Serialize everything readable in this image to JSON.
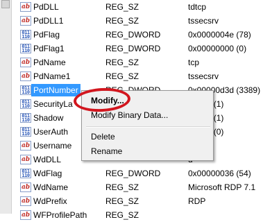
{
  "rows": [
    {
      "name": "PdDLL",
      "type": "REG_SZ",
      "data": "tdtcp",
      "icon": "string-value-icon"
    },
    {
      "name": "PdDLL1",
      "type": "REG_SZ",
      "data": "tssecsrv",
      "icon": "string-value-icon"
    },
    {
      "name": "PdFlag",
      "type": "REG_DWORD",
      "data": "0x0000004e (78)",
      "icon": "binary-value-icon"
    },
    {
      "name": "PdFlag1",
      "type": "REG_DWORD",
      "data": "0x00000000 (0)",
      "icon": "binary-value-icon"
    },
    {
      "name": "PdName",
      "type": "REG_SZ",
      "data": "tcp",
      "icon": "string-value-icon"
    },
    {
      "name": "PdName1",
      "type": "REG_SZ",
      "data": "tssecsrv",
      "icon": "string-value-icon"
    },
    {
      "name": "PortNumber",
      "type": "REG_DWORD",
      "data": "0x00000d3d (3389)",
      "icon": "binary-value-icon",
      "selected": true
    },
    {
      "name": "SecurityLa",
      "type": "",
      "data": "00001 (1)",
      "icon": "binary-value-icon"
    },
    {
      "name": "Shadow",
      "type": "",
      "data": "00001 (1)",
      "icon": "binary-value-icon"
    },
    {
      "name": "UserAuth",
      "type": "",
      "data": "00000 (0)",
      "icon": "binary-value-icon"
    },
    {
      "name": "Username",
      "type": "",
      "data": "",
      "icon": "string-value-icon"
    },
    {
      "name": "WdDLL",
      "type": "",
      "data": "d",
      "icon": "string-value-icon"
    },
    {
      "name": "WdFlag",
      "type": "REG_DWORD",
      "data": "0x00000036 (54)",
      "icon": "binary-value-icon"
    },
    {
      "name": "WdName",
      "type": "REG_SZ",
      "data": "Microsoft RDP 7.1",
      "icon": "string-value-icon"
    },
    {
      "name": "WdPrefix",
      "type": "REG_SZ",
      "data": "RDP",
      "icon": "string-value-icon"
    },
    {
      "name": "WFProfilePath",
      "type": "REG_SZ",
      "data": "",
      "icon": "string-value-icon"
    }
  ],
  "context_menu": {
    "modify": "Modify...",
    "modify_binary": "Modify Binary Data...",
    "delete": "Delete",
    "rename": "Rename"
  },
  "icon_glyphs": {
    "string": "ab",
    "binary": "011\n110"
  },
  "colors": {
    "selection": "#3399ff",
    "annotation_ring": "#d2161e",
    "menu_background": "#f0f0f0"
  }
}
